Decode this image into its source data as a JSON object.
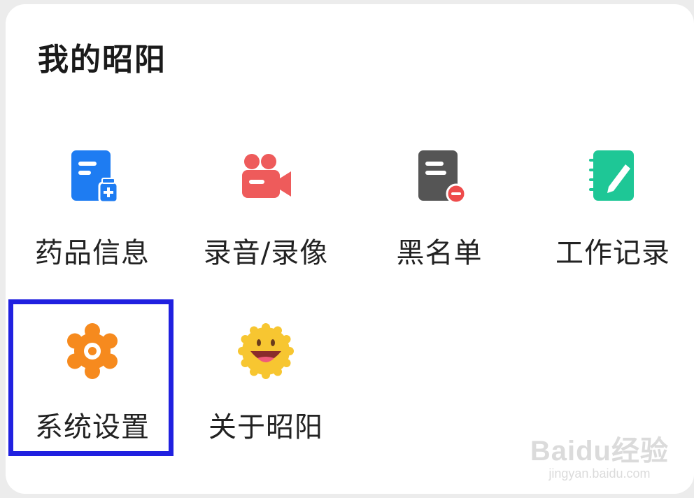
{
  "section": {
    "title": "我的昭阳"
  },
  "items": [
    {
      "label": "药品信息",
      "icon": "medicine-info-icon",
      "color": "#1e7cf2"
    },
    {
      "label": "录音/录像",
      "icon": "video-camera-icon",
      "color": "#ee5b5b"
    },
    {
      "label": "黑名单",
      "icon": "blacklist-icon",
      "color": "#555555"
    },
    {
      "label": "工作记录",
      "icon": "work-notebook-icon",
      "color": "#1ec796"
    },
    {
      "label": "系统设置",
      "icon": "gear-icon",
      "color": "#f68a1e"
    },
    {
      "label": "关于昭阳",
      "icon": "smiley-sun-icon",
      "color": "#f7c631"
    }
  ],
  "highlight": {
    "target": "系统设置",
    "color": "#2020e0"
  },
  "watermark": {
    "brand": "Baidu经验",
    "url": "jingyan.baidu.com"
  }
}
